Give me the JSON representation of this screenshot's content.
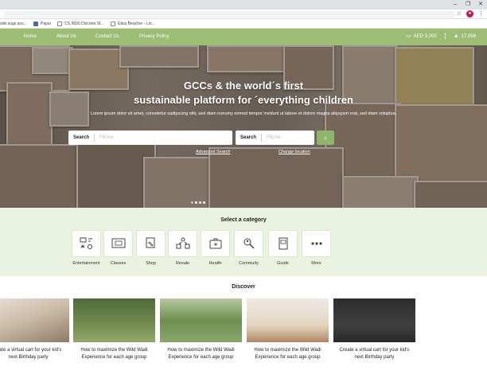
{
  "browser": {
    "window_controls": [
      "–",
      "❐",
      "✕"
    ],
    "bookmarks": [
      "ode sugs aos...",
      "Paper",
      "CS 5600 Discrete St...",
      "Gitsu Beacher - Lin..."
    ]
  },
  "nav": {
    "links": [
      "Home",
      "About Us",
      "Contact Us",
      "Privacy Policy"
    ],
    "balance": "AED 3,200",
    "points": "17,058"
  },
  "hero": {
    "title_line1": "GCCs & the world´s first",
    "title_line2": "sustainable platform for ´everything children",
    "subtitle": "Lorem ipsum dolor sit amet, consetetur sadipscing elitr, sed diam nonumy eirmod tempor invidunt ut labore et dolore magna aliquyam erat, sed diam voluptua.",
    "search1_label": "Search",
    "search1_placeholder": "Fill.me",
    "search2_label": "Search",
    "search2_placeholder": "Fill.me",
    "go": "›",
    "advanced_search": "Advanced Search",
    "change_location": "Change location"
  },
  "categories": {
    "heading": "Select a category",
    "items": [
      {
        "label": "Entertainment",
        "icon": "entertainment-icon"
      },
      {
        "label": "Classes",
        "icon": "classes-icon"
      },
      {
        "label": "Shop",
        "icon": "shop-icon"
      },
      {
        "label": "Resale",
        "icon": "resale-icon"
      },
      {
        "label": "Health",
        "icon": "health-icon"
      },
      {
        "label": "Commuity",
        "icon": "community-icon"
      },
      {
        "label": "Guide",
        "icon": "guide-icon"
      },
      {
        "label": "More",
        "icon": "more-icon"
      }
    ]
  },
  "discover": {
    "heading": "Discover",
    "cards": [
      {
        "caption": "reate a virtual cart for your kid's next Birthday party"
      },
      {
        "caption": "How to maximize the Wild Wadi Experience for each age group"
      },
      {
        "caption": "How to maximize the Wild Wadi Experience for each age group"
      },
      {
        "caption": "How to maximize the Wild Wadi Experience for each age group"
      },
      {
        "caption": "Create a virtual cart for your kid's next Birthday party"
      }
    ]
  },
  "colors": {
    "accent_green": "#9cbd74",
    "category_bg": "#eaf2e0"
  }
}
